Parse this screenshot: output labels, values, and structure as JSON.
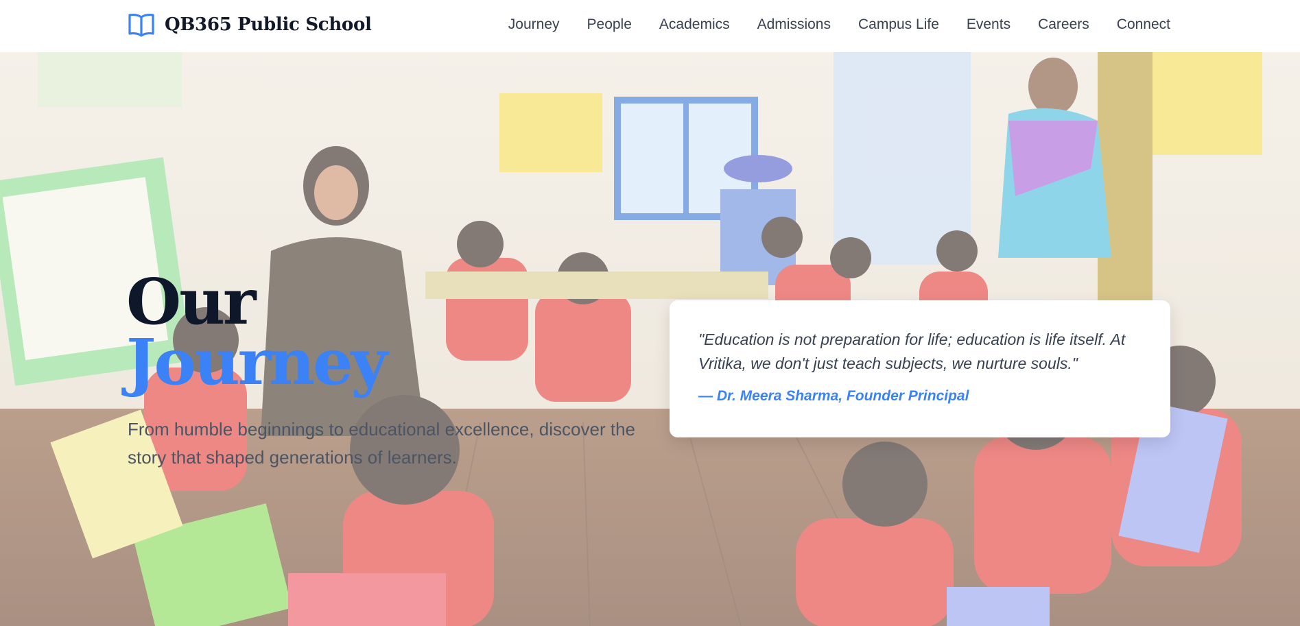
{
  "brand": {
    "name": "QB365 Public School",
    "icon": "open-book-icon",
    "accent_color": "#3b82f6"
  },
  "nav": {
    "items": [
      {
        "label": "Journey"
      },
      {
        "label": "People"
      },
      {
        "label": "Academics"
      },
      {
        "label": "Admissions"
      },
      {
        "label": "Campus Life"
      },
      {
        "label": "Events"
      },
      {
        "label": "Careers"
      },
      {
        "label": "Connect"
      }
    ]
  },
  "hero": {
    "title_line_1": "Our",
    "title_line_2": "Journey",
    "subtitle": "From humble beginnings to educational excellence, discover the story that shaped generations of learners.",
    "background": "classroom-photo-children-and-teacher"
  },
  "quote": {
    "text": "\"Education is not preparation for life; education is life itself. At Vritika, we don't just teach subjects, we nurture souls.\"",
    "author": "— Dr. Meera Sharma, Founder Principal"
  }
}
